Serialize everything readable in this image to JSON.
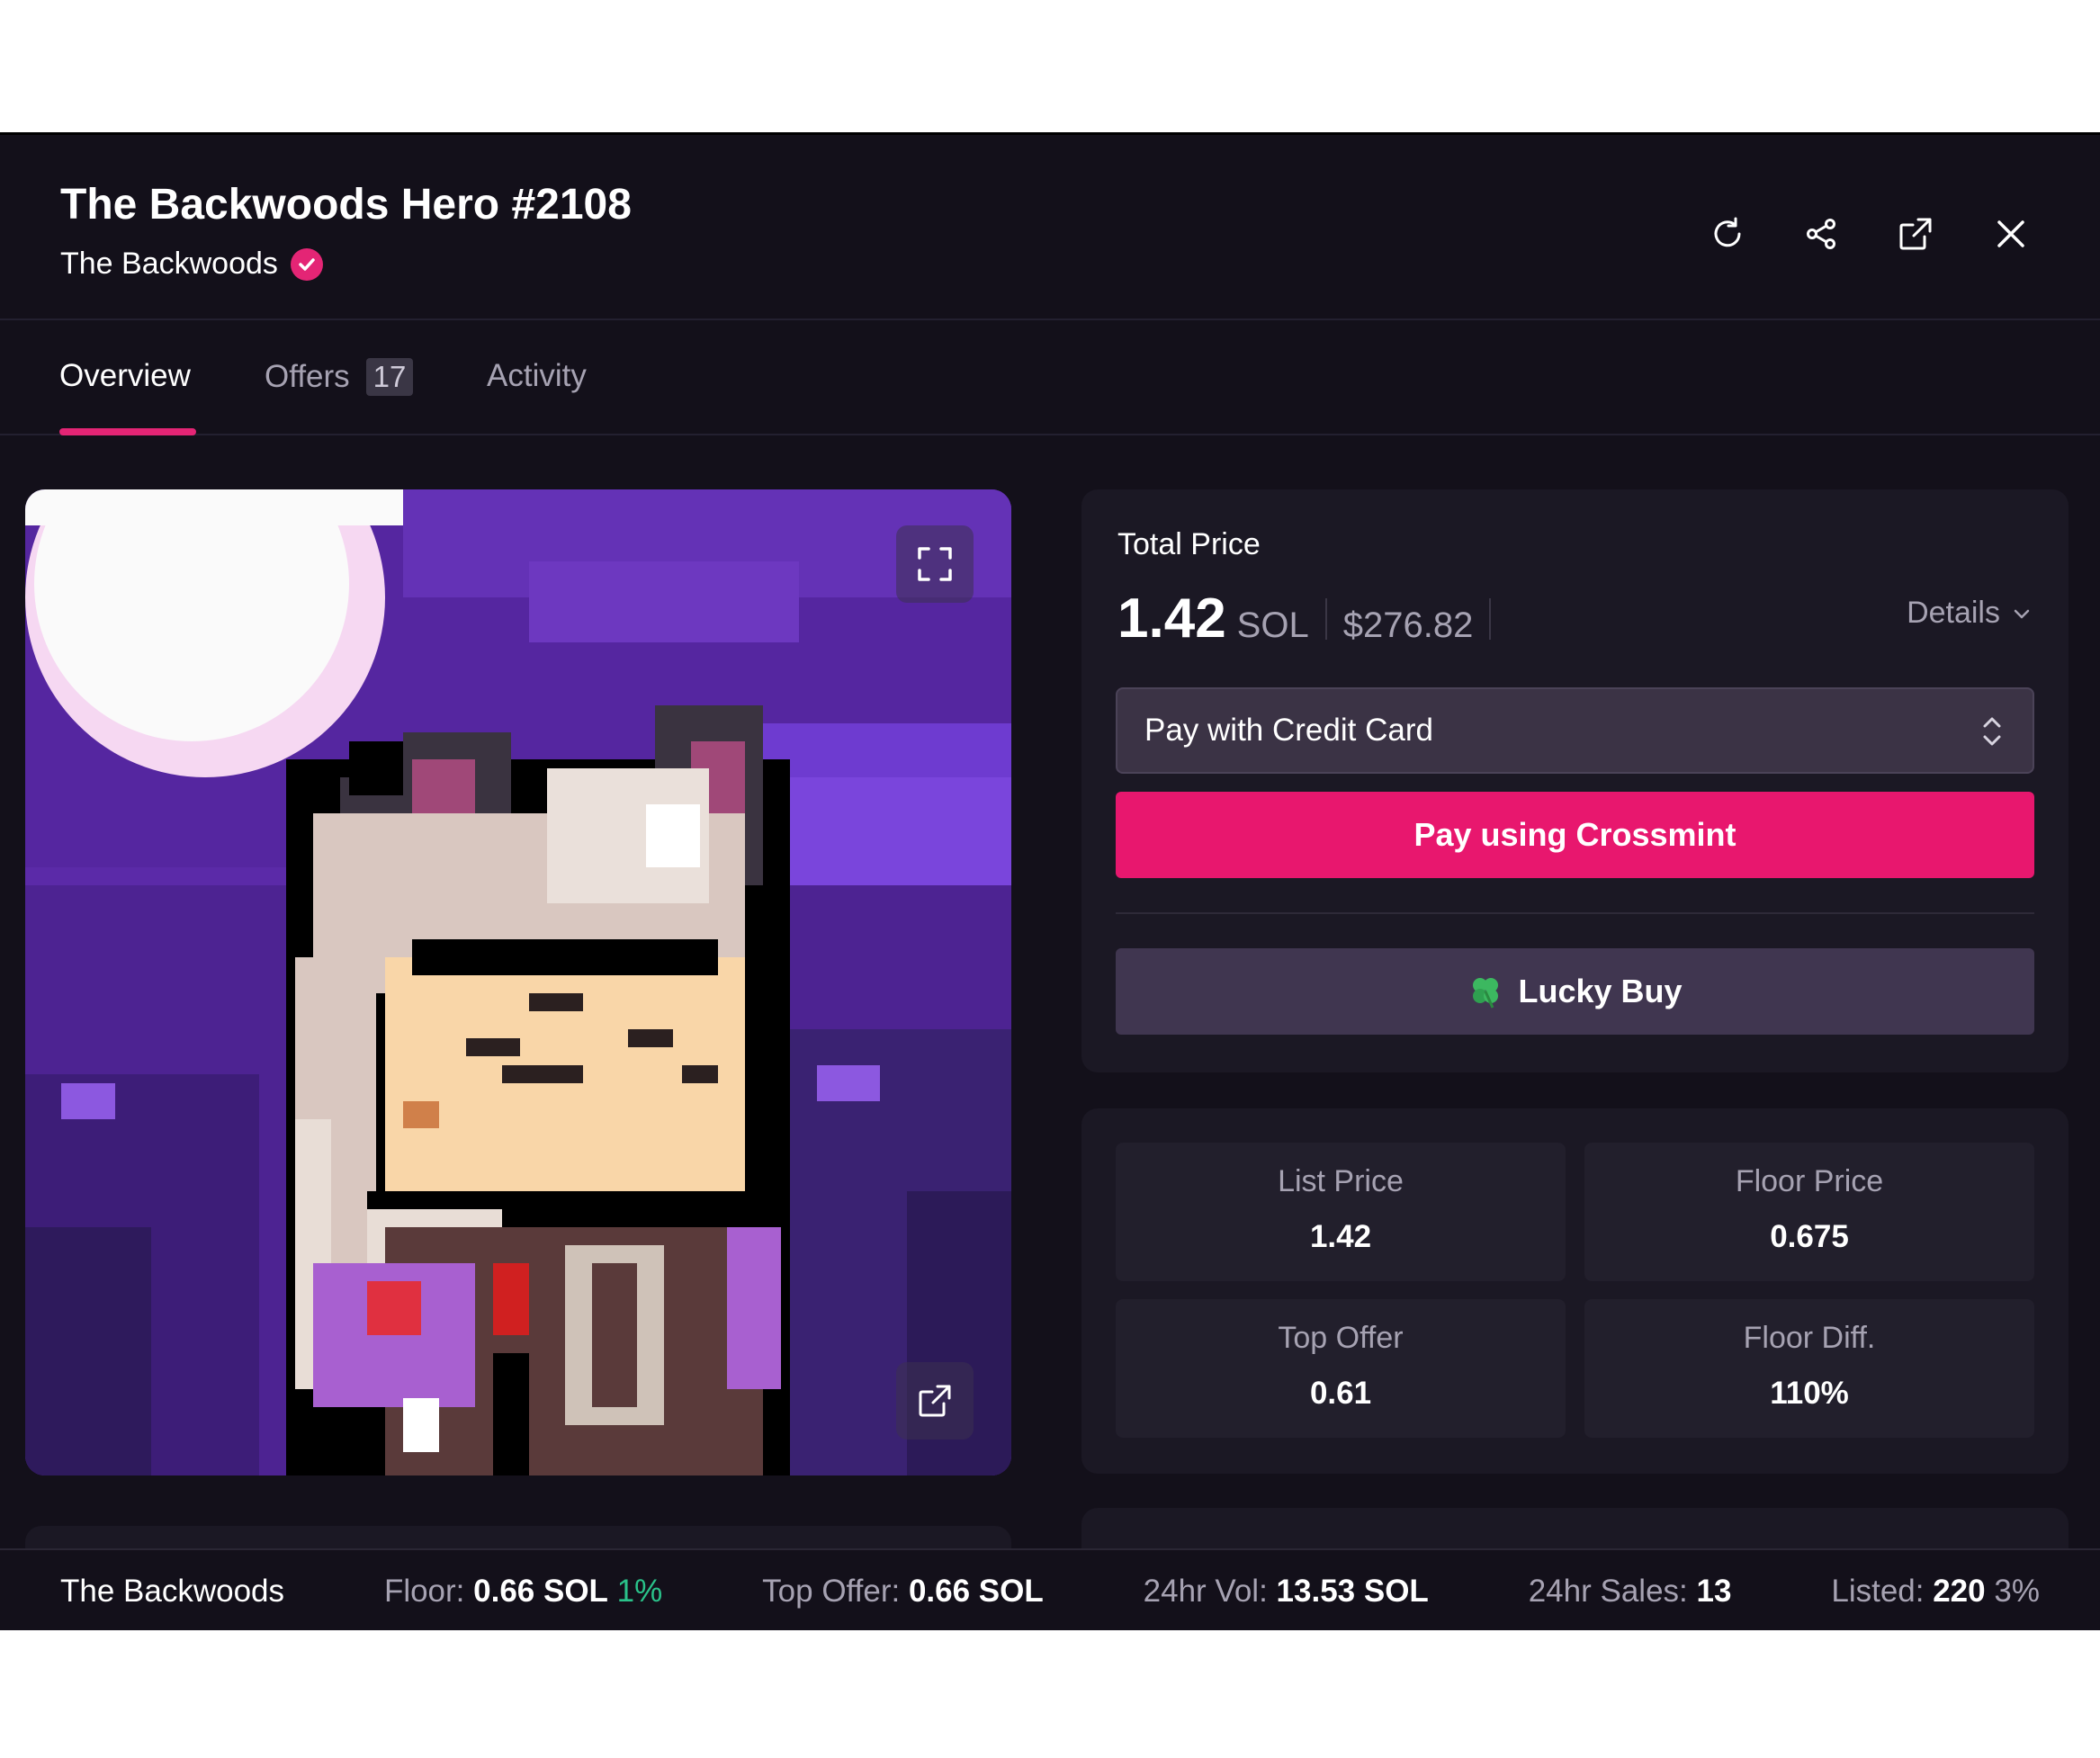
{
  "header": {
    "title": "The Backwoods Hero #2108",
    "collection": "The Backwoods",
    "icons": [
      "refresh-icon",
      "share-icon",
      "external-link-icon",
      "close-icon"
    ]
  },
  "tabs": [
    {
      "label": "Overview",
      "active": true
    },
    {
      "label": "Offers",
      "badge": "17"
    },
    {
      "label": "Activity"
    }
  ],
  "purchase": {
    "total_label": "Total Price",
    "price": "1.42",
    "currency": "SOL",
    "usd": "$276.82",
    "details_label": "Details",
    "payment_method": "Pay with Credit Card",
    "pay_button": "Pay using Crossmint",
    "lucky_button": "Lucky Buy"
  },
  "stats": [
    {
      "label": "List Price",
      "value": "1.42"
    },
    {
      "label": "Floor Price",
      "value": "0.675"
    },
    {
      "label": "Top Offer",
      "value": "0.61"
    },
    {
      "label": "Floor Diff.",
      "value": "110%"
    }
  ],
  "footer": {
    "collection": "The Backwoods",
    "floor_label": "Floor:",
    "floor_value": "0.66 SOL",
    "floor_change": "1%",
    "top_offer_label": "Top Offer:",
    "top_offer_value": "0.66 SOL",
    "vol_label": "24hr Vol:",
    "vol_value": "13.53 SOL",
    "sales_label": "24hr Sales:",
    "sales_value": "13",
    "listed_label": "Listed:",
    "listed_value": "220",
    "listed_pct": "3%"
  },
  "colors": {
    "accent": "#e8176e",
    "background": "#13101a",
    "card": "#1b1824",
    "positive": "#2ac28a"
  }
}
